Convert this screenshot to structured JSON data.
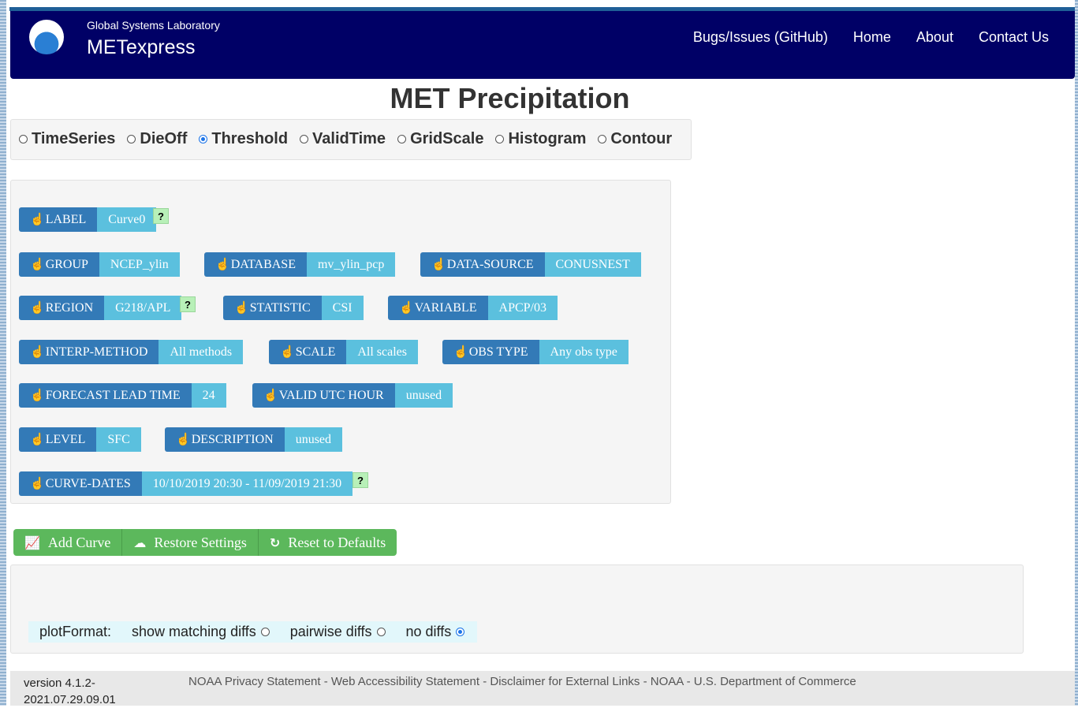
{
  "header": {
    "logo_text": "NOAA",
    "lab": "Global Systems Laboratory",
    "brand": "METexpress",
    "nav": [
      "Bugs/Issues (GitHub)",
      "Home",
      "About",
      "Contact Us"
    ]
  },
  "page_title": "MET Precipitation",
  "plot_types": {
    "options": [
      "TimeSeries",
      "DieOff",
      "Threshold",
      "ValidTime",
      "GridScale",
      "Histogram",
      "Contour"
    ],
    "selected": "Threshold"
  },
  "selectors": {
    "label": {
      "name": "LABEL",
      "value": "Curve0"
    },
    "group": {
      "name": "GROUP",
      "value": "NCEP_ylin"
    },
    "database": {
      "name": "DATABASE",
      "value": "mv_ylin_pcp"
    },
    "data_source": {
      "name": "DATA-SOURCE",
      "value": "CONUSNEST"
    },
    "region": {
      "name": "REGION",
      "value": "G218/APL"
    },
    "statistic": {
      "name": "STATISTIC",
      "value": "CSI"
    },
    "variable": {
      "name": "VARIABLE",
      "value": "APCP/03"
    },
    "interp_method": {
      "name": "INTERP-METHOD",
      "value": "All methods"
    },
    "scale": {
      "name": "SCALE",
      "value": "All scales"
    },
    "obs_type": {
      "name": "OBS TYPE",
      "value": "Any obs type"
    },
    "forecast_lead_time": {
      "name": "FORECAST LEAD TIME",
      "value": "24"
    },
    "valid_utc_hour": {
      "name": "VALID UTC HOUR",
      "value": "unused"
    },
    "level": {
      "name": "LEVEL",
      "value": "SFC"
    },
    "description": {
      "name": "DESCRIPTION",
      "value": "unused"
    },
    "curve_dates": {
      "name": "CURVE-DATES",
      "value": "10/10/2019 20:30 - 11/09/2019 21:30"
    },
    "help_glyph": "?"
  },
  "actions": {
    "add_curve": "Add Curve",
    "restore_settings": "Restore Settings",
    "reset_defaults": "Reset to Defaults"
  },
  "plot_format": {
    "label": "plotFormat:",
    "options": [
      "show matching diffs",
      "pairwise diffs",
      "no diffs"
    ],
    "selected": "no diffs"
  },
  "footer": {
    "version_line1": "version 4.1.2-",
    "version_line2": "2021.07.29.09.01",
    "links": "NOAA Privacy Statement - Web Accessibility Statement - Disclaimer for External Links - NOAA - U.S. Department of Commerce"
  },
  "colors": {
    "navbar": "#000066",
    "selector_button": "#337ab7",
    "selector_value": "#5bc0de",
    "action_green": "#5cb85c",
    "help_bg": "#b8f0b8"
  }
}
